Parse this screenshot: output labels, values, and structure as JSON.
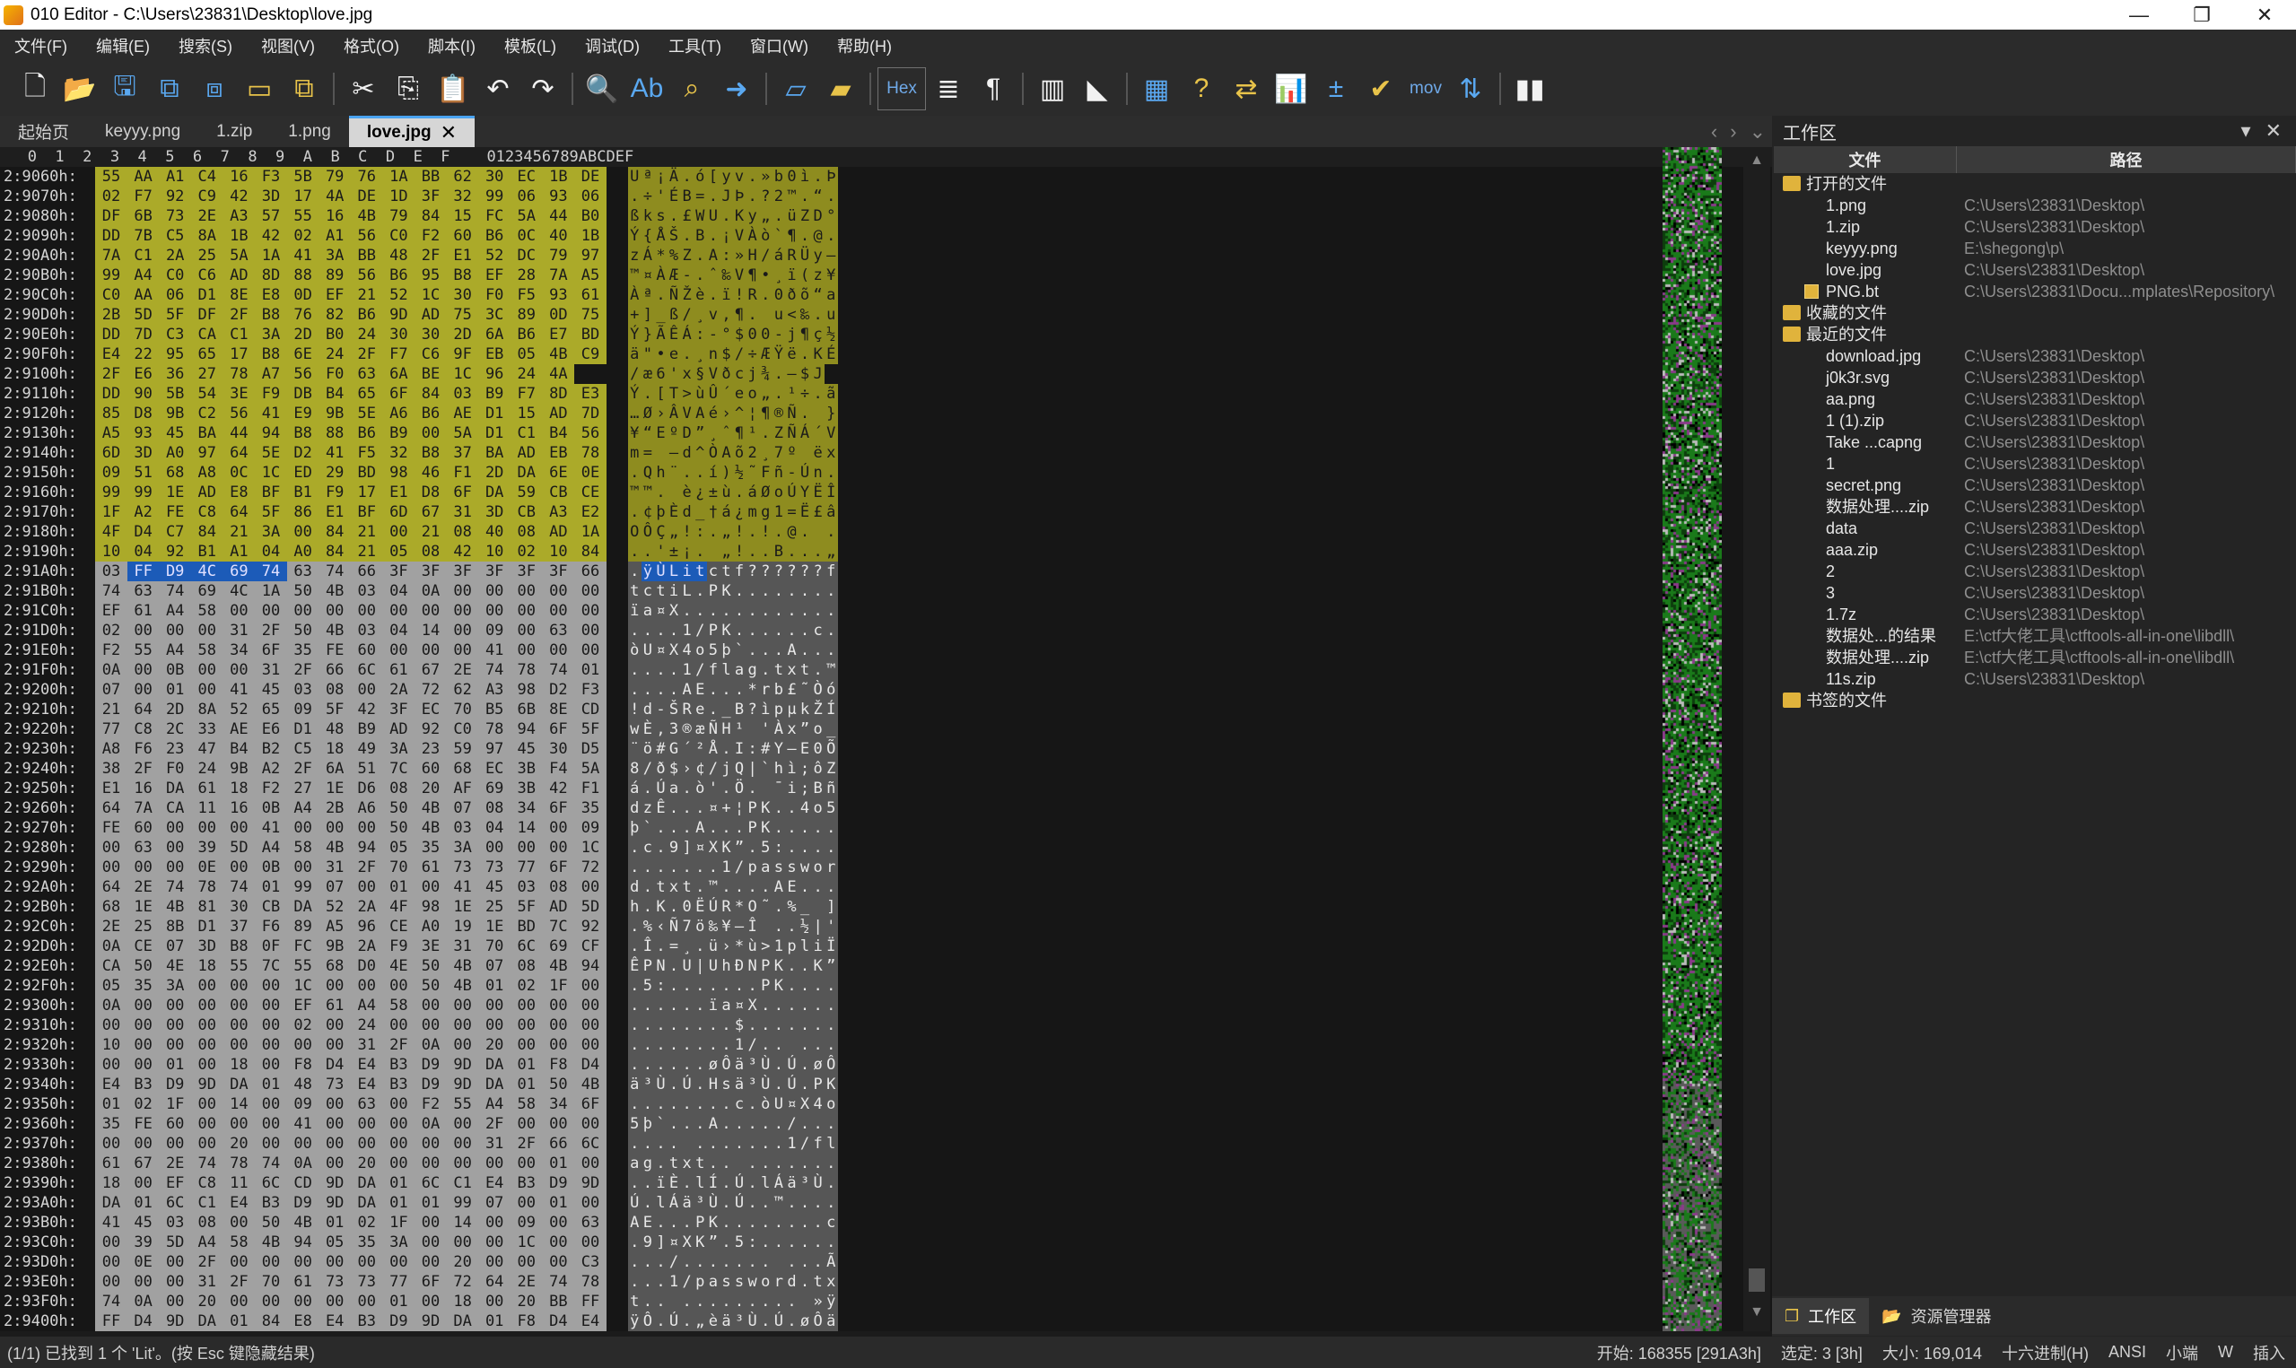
{
  "window": {
    "title": "010 Editor - C:\\Users\\23831\\Desktop\\love.jpg"
  },
  "menu": [
    "文件(F)",
    "编辑(E)",
    "搜索(S)",
    "视图(V)",
    "格式(O)",
    "脚本(I)",
    "模板(L)",
    "调试(D)",
    "工具(T)",
    "窗口(W)",
    "帮助(H)"
  ],
  "toolbar": {
    "hex_label": "Hex",
    "mov_label": "mov",
    "pilcrow": "¶"
  },
  "tabs": [
    {
      "label": "起始页",
      "active": false
    },
    {
      "label": "keyyy.png",
      "active": false
    },
    {
      "label": "1.zip",
      "active": false
    },
    {
      "label": "1.png",
      "active": false
    },
    {
      "label": "love.jpg",
      "active": true
    }
  ],
  "hex": {
    "col_header": "   0  1  2  3  4  5  6  7  8  9  A  B  C  D  E  F    0123456789ABCDEF",
    "rows": [
      {
        "addr": "2:9060h:",
        "hex": "55 AA A1 C4 16 F3 5B 79 76 1A BB 62 30 EC 1B DE",
        "ascii": "Uª¡Ä.ó[yv.»b0ì.Þ",
        "hl": true
      },
      {
        "addr": "2:9070h:",
        "hex": "02 F7 92 C9 42 3D 17 4A DE 1D 3F 32 99 06 93 06",
        "ascii": ".÷'ÉB=.JÞ.?2™.“.",
        "hl": true
      },
      {
        "addr": "2:9080h:",
        "hex": "DF 6B 73 2E A3 57 55 16 4B 79 84 15 FC 5A 44 B0",
        "ascii": "ßks.£WU.Ky„.üZD°",
        "hl": true
      },
      {
        "addr": "2:9090h:",
        "hex": "DD 7B C5 8A 1B 42 02 A1 56 C0 F2 60 B6 0C 40 1B",
        "ascii": "Ý{ÅŠ.B.¡VÀò`¶.@.",
        "hl": true
      },
      {
        "addr": "2:90A0h:",
        "hex": "7A C1 2A 25 5A 1A 41 3A BB 48 2F E1 52 DC 79 97",
        "ascii": "zÁ*%Z.A:»H/áRÜy—",
        "hl": true
      },
      {
        "addr": "2:90B0h:",
        "hex": "99 A4 C0 C6 AD 8D 88 89 56 B6 95 B8 EF 28 7A A5",
        "ascii": "™¤ÀÆ-.ˆ‰V¶•¸ï(z¥",
        "hl": true
      },
      {
        "addr": "2:90C0h:",
        "hex": "C0 AA 06 D1 8E E8 0D EF 21 52 1C 30 F0 F5 93 61",
        "ascii": "Àª.ÑŽè.ï!R.0ðõ“a",
        "hl": true
      },
      {
        "addr": "2:90D0h:",
        "hex": "2B 5D 5F DF 2F B8 76 82 B6 9D AD 75 3C 89 0D 75",
        "ascii": "+]_ß/¸v‚¶.­u<‰.u",
        "hl": true
      },
      {
        "addr": "2:90E0h:",
        "hex": "DD 7D C3 CA C1 3A 2D B0 24 30 30 2D 6A B6 E7 BD",
        "ascii": "Ý}ÃÊÁ:-°$00-j¶ç½",
        "hl": true
      },
      {
        "addr": "2:90F0h:",
        "hex": "E4 22 95 65 17 B8 6E 24 2F F7 C6 9F EB 05 4B C9",
        "ascii": "ä\"•e.¸n$/÷ÆŸë.KÉ",
        "hl": true
      },
      {
        "addr": "2:9100h:",
        "hex": "2F E6 36 27 78 A7 56 F0 63 6A BE 1C 96 24 4A",
        "ascii": "/æ6'x§Vðcj¾.–$J",
        "hl": true
      },
      {
        "addr": "2:9110h:",
        "hex": "DD 90 5B 54 3E F9 DB B4 65 6F 84 03 B9 F7 8D E3",
        "ascii": "Ý.[T>ùÛ´eo„.¹÷.ã",
        "hl": true
      },
      {
        "addr": "2:9120h:",
        "hex": "85 D8 9B C2 56 41 E9 9B 5E A6 B6 AE D1 15 AD 7D",
        "ascii": "…Ø›ÂVAé›^¦¶®Ñ.­}",
        "hl": true
      },
      {
        "addr": "2:9130h:",
        "hex": "A5 93 45 BA 44 94 B8 88 B6 B9 00 5A D1 C1 B4 56",
        "ascii": "¥“EºD”¸ˆ¶¹.ZÑÁ´V",
        "hl": true
      },
      {
        "addr": "2:9140h:",
        "hex": "6D 3D A0 97 64 5E D2 41 F5 32 B8 37 BA AD EB 78",
        "ascii": "m= —d^ÒAõ2¸7º­ëx",
        "hl": true
      },
      {
        "addr": "2:9150h:",
        "hex": "09 51 68 A8 0C 1C ED 29 BD 98 46 F1 2D DA 6E 0E",
        "ascii": ".Qh¨..í)½˜Fñ-Ún.",
        "hl": true
      },
      {
        "addr": "2:9160h:",
        "hex": "99 99 1E AD E8 BF B1 F9 17 E1 D8 6F DA 59 CB CE",
        "ascii": "™™.­è¿±ù.áØoÚYËÎ",
        "hl": true
      },
      {
        "addr": "2:9170h:",
        "hex": "1F A2 FE C8 64 5F 86 E1 BF 6D 67 31 3D CB A3 E2",
        "ascii": ".¢þÈd_†á¿mg1=Ë£â",
        "hl": true
      },
      {
        "addr": "2:9180h:",
        "hex": "4F D4 C7 84 21 3A 00 84 21 00 21 08 40 08 AD 1A",
        "ascii": "OÔÇ„!:.„!.!.@.­.",
        "hl": true
      },
      {
        "addr": "2:9190h:",
        "hex": "10 04 92 B1 A1 04 A0 84 21 05 08 42 10 02 10 84",
        "ascii": "..'±¡. „!..B...„",
        "hl": true
      },
      {
        "addr": "2:91A0h:",
        "hex": "03 FF D9 4C 69 74 63 74 66 3F 3F 3F 3F 3F 3F 66",
        "ascii": ".ÿÙLitctf??????f",
        "hl": false,
        "sel": [
          1,
          2,
          3,
          4,
          5
        ]
      },
      {
        "addr": "2:91B0h:",
        "hex": "74 63 74 69 4C 1A 50 4B 03 04 0A 00 00 00 00 00",
        "ascii": "tctiL.PK........",
        "hl": false
      },
      {
        "addr": "2:91C0h:",
        "hex": "EF 61 A4 58 00 00 00 00 00 00 00 00 00 00 00 00",
        "ascii": "ïa¤X............",
        "hl": false
      },
      {
        "addr": "2:91D0h:",
        "hex": "02 00 00 00 31 2F 50 4B 03 04 14 00 09 00 63 00",
        "ascii": "....1/PK......c.",
        "hl": false
      },
      {
        "addr": "2:91E0h:",
        "hex": "F2 55 A4 58 34 6F 35 FE 60 00 00 00 41 00 00 00",
        "ascii": "òU¤X4o5þ`...A...",
        "hl": false
      },
      {
        "addr": "2:91F0h:",
        "hex": "0A 00 0B 00 00 31 2F 66 6C 61 67 2E 74 78 74 01 99",
        "ascii": "....1/flag.txt.™",
        "hl": false
      },
      {
        "addr": "2:9200h:",
        "hex": "07 00 01 00 41 45 03 08 00 2A 72 62 A3 98 D2 F3",
        "ascii": "....AE...*rb£˜Òó",
        "hl": false
      },
      {
        "addr": "2:9210h:",
        "hex": "21 64 2D 8A 52 65 09 5F 42 3F EC 70 B5 6B 8E CD",
        "ascii": "!d-ŠRe._B?ìpµkŽÍ",
        "hl": false
      },
      {
        "addr": "2:9220h:",
        "hex": "77 C8 2C 33 AE E6 D1 48 B9 AD 92 C0 78 94 6F 5F",
        "ascii": "wÈ,3®æÑH¹­'Àx”o_",
        "hl": false
      },
      {
        "addr": "2:9230h:",
        "hex": "A8 F6 23 47 B4 B2 C5 18 49 3A 23 59 97 45 30 D5",
        "ascii": "¨ö#G´²Å.I:#Y—E0Õ",
        "hl": false
      },
      {
        "addr": "2:9240h:",
        "hex": "38 2F F0 24 9B A2 2F 6A 51 7C 60 68 EC 3B F4 5A",
        "ascii": "8/ð$›¢/jQ|`hì;ôZ",
        "hl": false
      },
      {
        "addr": "2:9250h:",
        "hex": "E1 16 DA 61 18 F2 27 1E D6 08 20 AF 69 3B 42 F1",
        "ascii": "á.Úa.ò'.Ö. ¯i;Bñ",
        "hl": false
      },
      {
        "addr": "2:9260h:",
        "hex": "64 7A CA 11 16 0B A4 2B A6 50 4B 07 08 34 6F 35",
        "ascii": "dzÊ...¤+¦PK..4o5",
        "hl": false
      },
      {
        "addr": "2:9270h:",
        "hex": "FE 60 00 00 00 41 00 00 00 50 4B 03 04 14 00 09",
        "ascii": "þ`...A...PK.....",
        "hl": false
      },
      {
        "addr": "2:9280h:",
        "hex": "00 63 00 39 5D A4 58 4B 94 05 35 3A 00 00 00 1C",
        "ascii": ".c.9]¤XK”.5:....",
        "hl": false
      },
      {
        "addr": "2:9290h:",
        "hex": "00 00 00 0E 00 0B 00 31 2F 70 61 73 73 77 6F 72",
        "ascii": ".......1/passwor",
        "hl": false
      },
      {
        "addr": "2:92A0h:",
        "hex": "64 2E 74 78 74 01 99 07 00 01 00 41 45 03 08 00",
        "ascii": "d.txt.™....AE...",
        "hl": false
      },
      {
        "addr": "2:92B0h:",
        "hex": "68 1E 4B 81 30 CB DA 52 2A 4F 98 1E 25 5F AD 5D",
        "ascii": "h.K.0ËÚR*O˜.%_­]",
        "hl": false
      },
      {
        "addr": "2:92C0h:",
        "hex": "2E 25 8B D1 37 F6 89 A5 96 CE A0 19 1E BD 7C 92",
        "ascii": ".%‹Ñ7ö‰¥–Î ..½|'",
        "hl": false
      },
      {
        "addr": "2:92D0h:",
        "hex": "0A CE 07 3D B8 0F FC 9B 2A F9 3E 31 70 6C 69 CF",
        "ascii": ".Î.=¸.ü›*ù>1pliÏ",
        "hl": false
      },
      {
        "addr": "2:92E0h:",
        "hex": "CA 50 4E 18 55 7C 55 68 D0 4E 50 4B 07 08 4B 94",
        "ascii": "ÊPN.U|UhÐNPK..K”",
        "hl": false
      },
      {
        "addr": "2:92F0h:",
        "hex": "05 35 3A 00 00 00 1C 00 00 00 50 4B 01 02 1F 00",
        "ascii": ".5:.......PK....",
        "hl": false
      },
      {
        "addr": "2:9300h:",
        "hex": "0A 00 00 00 00 00 EF 61 A4 58 00 00 00 00 00 00",
        "ascii": "......ïa¤X......",
        "hl": false
      },
      {
        "addr": "2:9310h:",
        "hex": "00 00 00 00 00 00 02 00 24 00 00 00 00 00 00 00",
        "ascii": "........$.......",
        "hl": false
      },
      {
        "addr": "2:9320h:",
        "hex": "10 00 00 00 00 00 00 00 31 2F 0A 00 20 00 00 00",
        "ascii": "........1/.. ...",
        "hl": false
      },
      {
        "addr": "2:9330h:",
        "hex": "00 00 01 00 18 00 F8 D4 E4 B3 D9 9D DA 01 F8 D4",
        "ascii": "......øÔä³Ù.Ú.øÔ",
        "hl": false
      },
      {
        "addr": "2:9340h:",
        "hex": "E4 B3 D9 9D DA 01 48 73 E4 B3 D9 9D DA 01 50 4B",
        "ascii": "ä³Ù.Ú.Hsä³Ù.Ú.PK",
        "hl": false
      },
      {
        "addr": "2:9350h:",
        "hex": "01 02 1F 00 14 00 09 00 63 00 F2 55 A4 58 34 6F",
        "ascii": "........c.òU¤X4o",
        "hl": false
      },
      {
        "addr": "2:9360h:",
        "hex": "35 FE 60 00 00 00 41 00 00 00 0A 00 2F 00 00 00",
        "ascii": "5þ`...A...../...",
        "hl": false
      },
      {
        "addr": "2:9370h:",
        "hex": "00 00 00 00 20 00 00 00 00 00 00 00 31 2F 66 6C",
        "ascii": ".... .......1/fl",
        "hl": false
      },
      {
        "addr": "2:9380h:",
        "hex": "61 67 2E 74 78 74 0A 00 20 00 00 00 00 00 01 00",
        "ascii": "ag.txt.. .......",
        "hl": false
      },
      {
        "addr": "2:9390h:",
        "hex": "18 00 EF C8 11 6C CD 9D DA 01 6C C1 E4 B3 D9 9D",
        "ascii": "..ïÈ.lÍ.Ú.lÁä³Ù.",
        "hl": false
      },
      {
        "addr": "2:93A0h:",
        "hex": "DA 01 6C C1 E4 B3 D9 9D DA 01 01 99 07 00 01 00",
        "ascii": "Ú.lÁä³Ù.Ú..™....",
        "hl": false
      },
      {
        "addr": "2:93B0h:",
        "hex": "41 45 03 08 00 50 4B 01 02 1F 00 14 00 09 00 63",
        "ascii": "AE...PK........c",
        "hl": false
      },
      {
        "addr": "2:93C0h:",
        "hex": "00 39 5D A4 58 4B 94 05 35 3A 00 00 00 1C 00 00",
        "ascii": ".9]¤XK”.5:......",
        "hl": false
      },
      {
        "addr": "2:93D0h:",
        "hex": "00 0E 00 2F 00 00 00 00 00 00 00 20 00 00 00 C3",
        "ascii": ".../....... ...Ã",
        "hl": false
      },
      {
        "addr": "2:93E0h:",
        "hex": "00 00 00 31 2F 70 61 73 73 77 6F 72 64 2E 74 78",
        "ascii": "...1/password.tx",
        "hl": false
      },
      {
        "addr": "2:93F0h:",
        "hex": "74 0A 00 20 00 00 00 00 00 01 00 18 00 20 BB FF",
        "ascii": "t.. ......... »ÿ",
        "hl": false
      },
      {
        "addr": "2:9400h:",
        "hex": "FF D4 9D DA 01 84 E8 E4 B3 D9 9D DA 01 F8 D4 E4",
        "ascii": "ÿÔ.Ú.„èä³Ù.Ú.øÔä",
        "hl": false
      }
    ]
  },
  "statusbar": {
    "left": "(1/1) 已找到 1 个 'Lit'。(按 Esc 键隐藏结果)",
    "start": "开始: 168355 [291A3h]",
    "selected": "选定: 3 [3h]",
    "size": "大小: 169,014",
    "mode": "十六进制(H)",
    "encoding": "ANSI",
    "endian": "小端",
    "w": "W",
    "insert": "插入"
  },
  "workspace": {
    "title": "工作区",
    "col_file": "文件",
    "col_path": "路径",
    "groups": [
      {
        "label": "打开的文件",
        "items": [
          {
            "name": "1.png",
            "path": "C:\\Users\\23831\\Desktop\\"
          },
          {
            "name": "1.zip",
            "path": "C:\\Users\\23831\\Desktop\\"
          },
          {
            "name": "keyyy.png",
            "path": "E:\\shegong\\p\\"
          },
          {
            "name": "love.jpg",
            "path": "C:\\Users\\23831\\Desktop\\"
          },
          {
            "name": "PNG.bt",
            "path": "C:\\Users\\23831\\Docu...mplates\\Repository\\"
          }
        ]
      },
      {
        "label": "收藏的文件",
        "items": []
      },
      {
        "label": "最近的文件",
        "items": [
          {
            "name": "download.jpg",
            "path": "C:\\Users\\23831\\Desktop\\"
          },
          {
            "name": "j0k3r.svg",
            "path": "C:\\Users\\23831\\Desktop\\"
          },
          {
            "name": "aa.png",
            "path": "C:\\Users\\23831\\Desktop\\"
          },
          {
            "name": "1 (1).zip",
            "path": "C:\\Users\\23831\\Desktop\\"
          },
          {
            "name": "Take ...capng",
            "path": "C:\\Users\\23831\\Desktop\\"
          },
          {
            "name": "1",
            "path": "C:\\Users\\23831\\Desktop\\"
          },
          {
            "name": "secret.png",
            "path": "C:\\Users\\23831\\Desktop\\"
          },
          {
            "name": "数据处理....zip",
            "path": "C:\\Users\\23831\\Desktop\\"
          },
          {
            "name": "data",
            "path": "C:\\Users\\23831\\Desktop\\"
          },
          {
            "name": "aaa.zip",
            "path": "C:\\Users\\23831\\Desktop\\"
          },
          {
            "name": "2",
            "path": "C:\\Users\\23831\\Desktop\\"
          },
          {
            "name": "3",
            "path": "C:\\Users\\23831\\Desktop\\"
          },
          {
            "name": "1.7z",
            "path": "C:\\Users\\23831\\Desktop\\"
          },
          {
            "name": "数据处...的结果",
            "path": "E:\\ctf大佬工具\\ctftools-all-in-one\\libdll\\"
          },
          {
            "name": "数据处理....zip",
            "path": "E:\\ctf大佬工具\\ctftools-all-in-one\\libdll\\"
          },
          {
            "name": "11s.zip",
            "path": "C:\\Users\\23831\\Desktop\\"
          }
        ]
      },
      {
        "label": "书签的文件",
        "items": []
      }
    ],
    "bottom_tabs": [
      "工作区",
      "资源管理器"
    ]
  },
  "colors": {
    "highlight": "#abaa29",
    "selection": "#1c5bb8",
    "accent": "#4aa3f0"
  }
}
